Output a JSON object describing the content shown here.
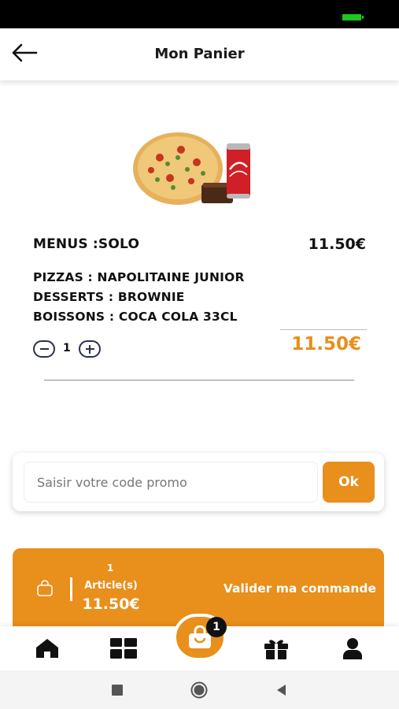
{
  "header": {
    "title": "Mon Panier"
  },
  "cart_item": {
    "menu_name": "MENUS :SOLO",
    "menu_price": "11.50€",
    "details": [
      "PIZZAS : NAPOLITAINE JUNIOR",
      "DESSERTS : BROWNIE",
      "BOISSONS : COCA COLA 33CL"
    ],
    "quantity": "1",
    "total": "11.50€"
  },
  "promo": {
    "placeholder": "Saisir votre code promo",
    "value": "",
    "ok_label": "Ok"
  },
  "checkout": {
    "article_count": "1",
    "article_label": "Article(s)",
    "total": "11.50€",
    "validate_label": "Valider ma commande"
  },
  "bottom_nav": {
    "items": [
      "home-icon",
      "menu-grid-icon",
      "cart-bag-icon",
      "gift-icon",
      "profile-icon"
    ],
    "cart_badge": "1"
  },
  "colors": {
    "accent": "#e88f1c",
    "text": "#111111",
    "quantity_controls": "#2b2f52"
  }
}
